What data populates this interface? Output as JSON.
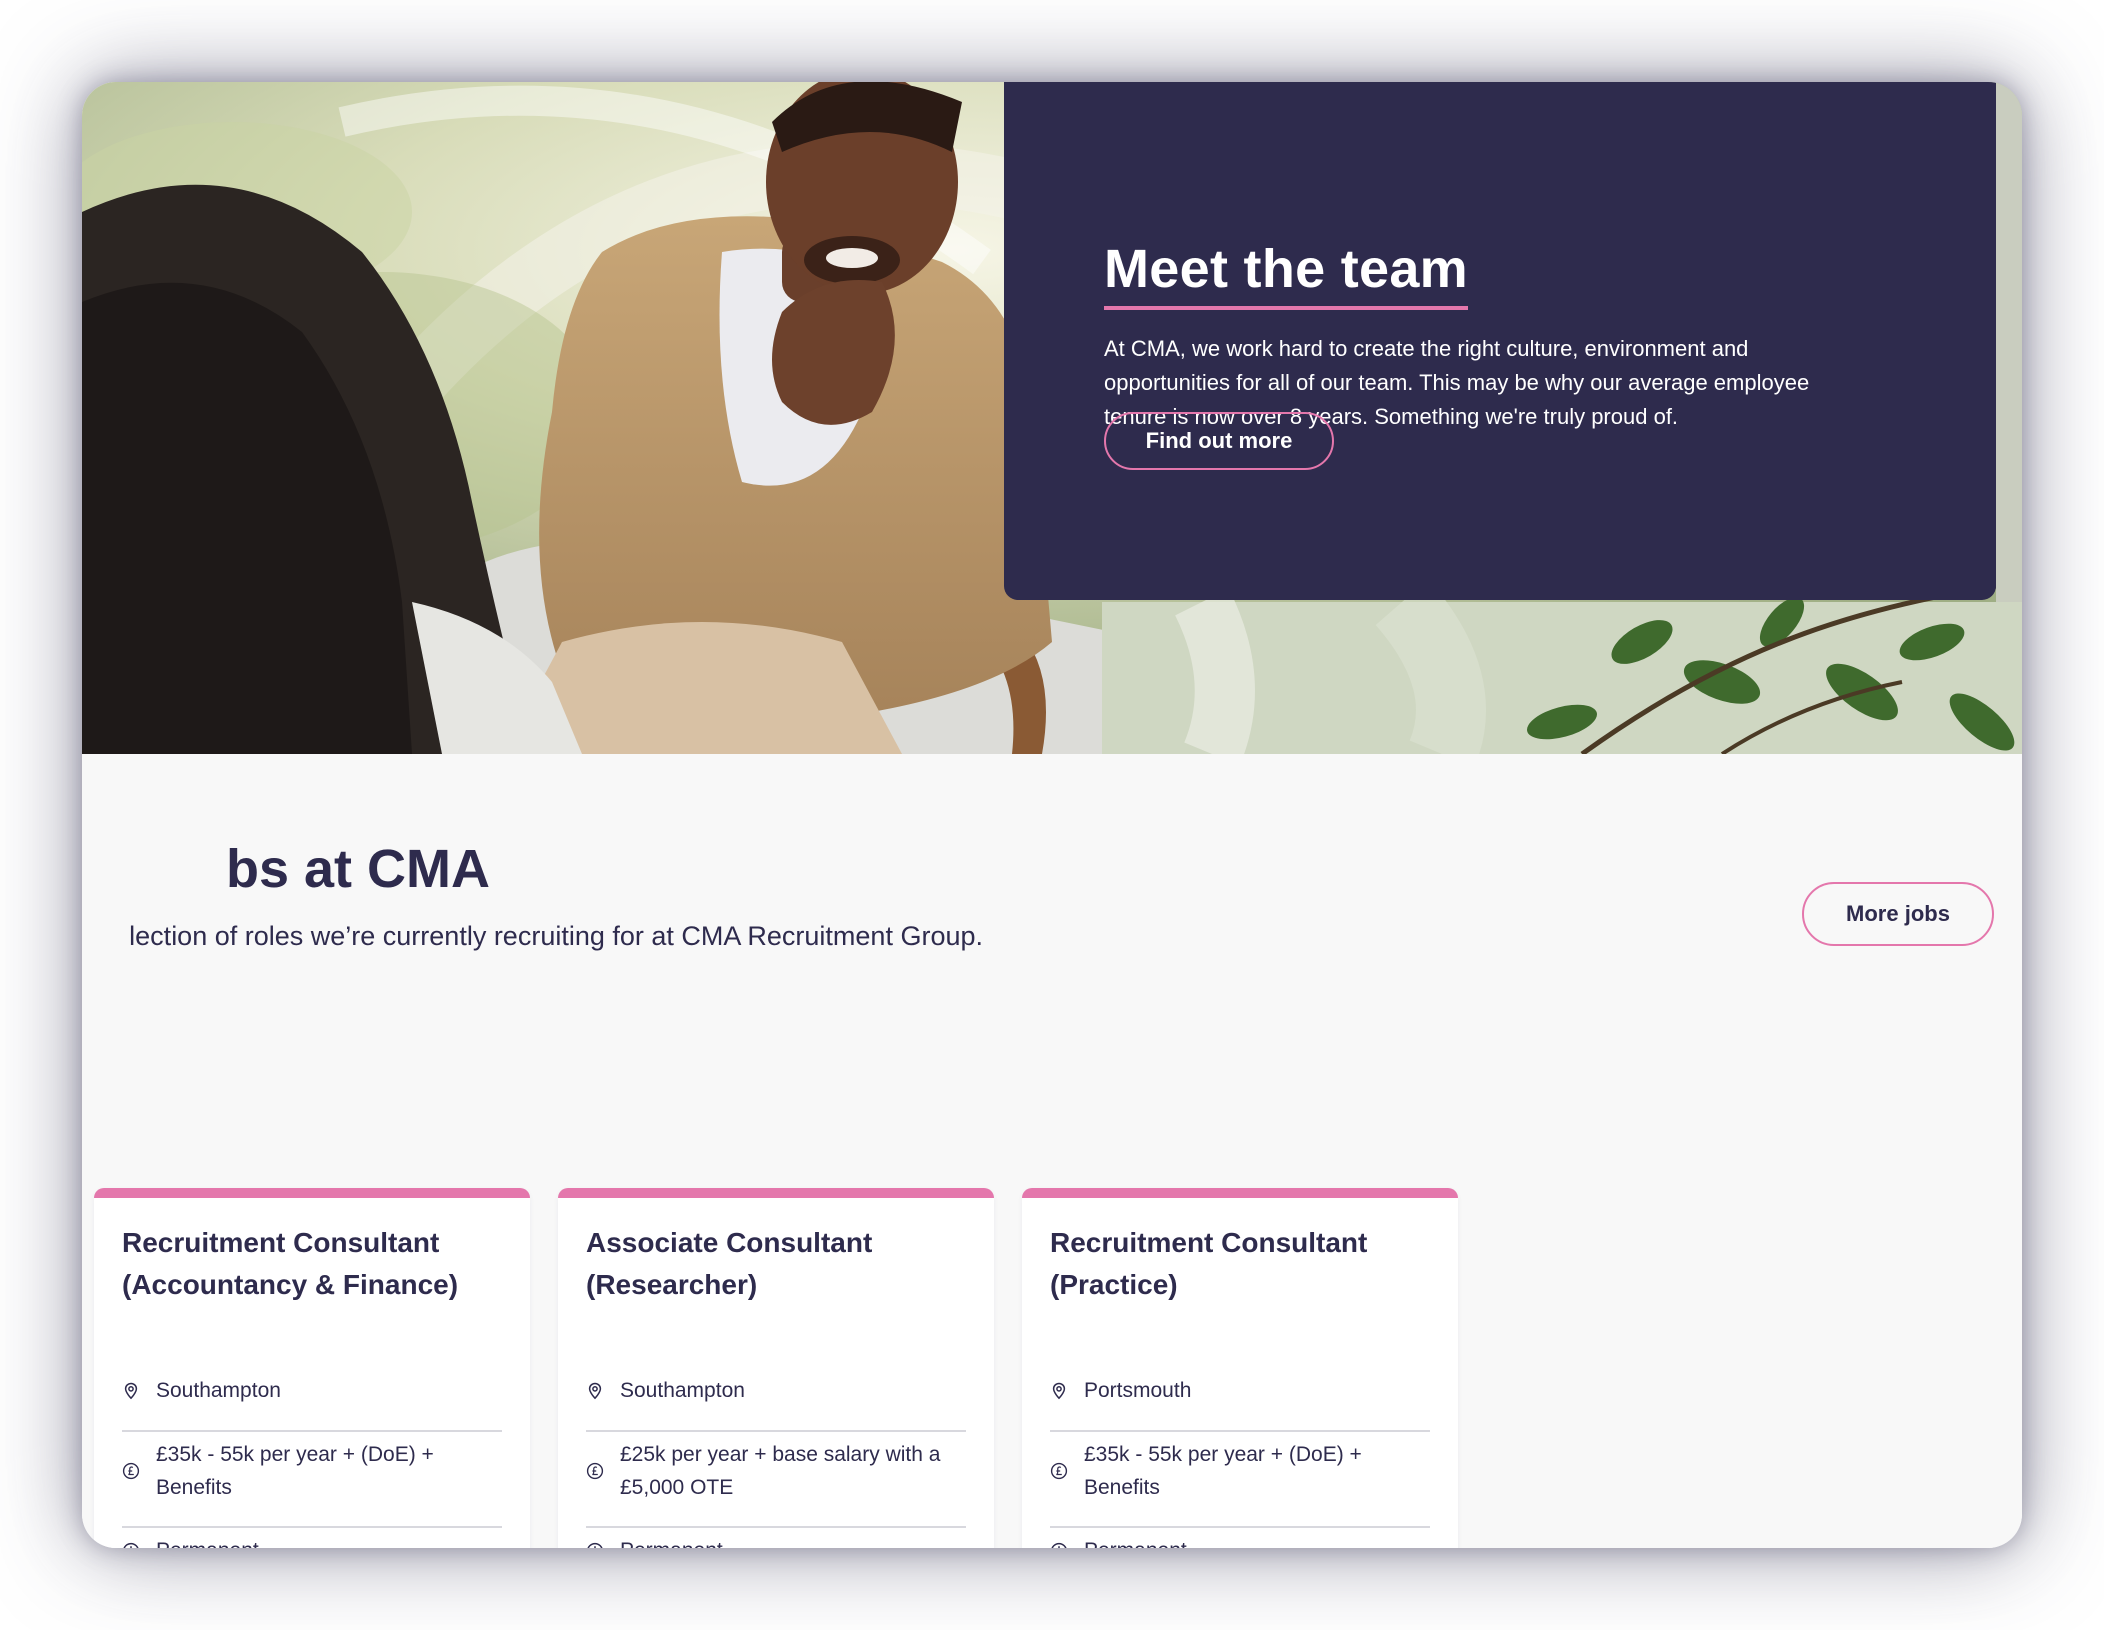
{
  "hero": {
    "title": "Meet the team",
    "body": "At CMA, we work hard to create the right culture, environment and opportunities for all of our team. This may be why our average employee tenure is now over 8 years. Something we're truly proud of.",
    "button_label": "Find out more"
  },
  "jobs": {
    "heading": "bs at CMA",
    "subheading": "lection of roles we’re currently recruiting for at CMA Recruitment Group.",
    "more_button_label": "More jobs",
    "cards": [
      {
        "title": "Recruitment Consultant (Accountancy & Finance)",
        "location": "Southampton",
        "salary": "£35k - 55k per year + (DoE) + Benefits",
        "type": "Permanent"
      },
      {
        "title": "Associate Consultant (Researcher)",
        "location": "Southampton",
        "salary": "£25k per year + base salary with a £5,000 OTE",
        "type": "Permanent"
      },
      {
        "title": "Recruitment Consultant (Practice)",
        "location": "Portsmouth",
        "salary": "£35k - 55k per year + (DoE) + Benefits",
        "type": "Permanent"
      }
    ]
  },
  "colors": {
    "navy": "#2e2b4d",
    "pink_accent": "#e477ac",
    "section_background": "#f8f8f8"
  },
  "icons": {
    "location": "map-pin-icon",
    "salary": "pound-coin-icon",
    "contract": "clock-icon"
  }
}
